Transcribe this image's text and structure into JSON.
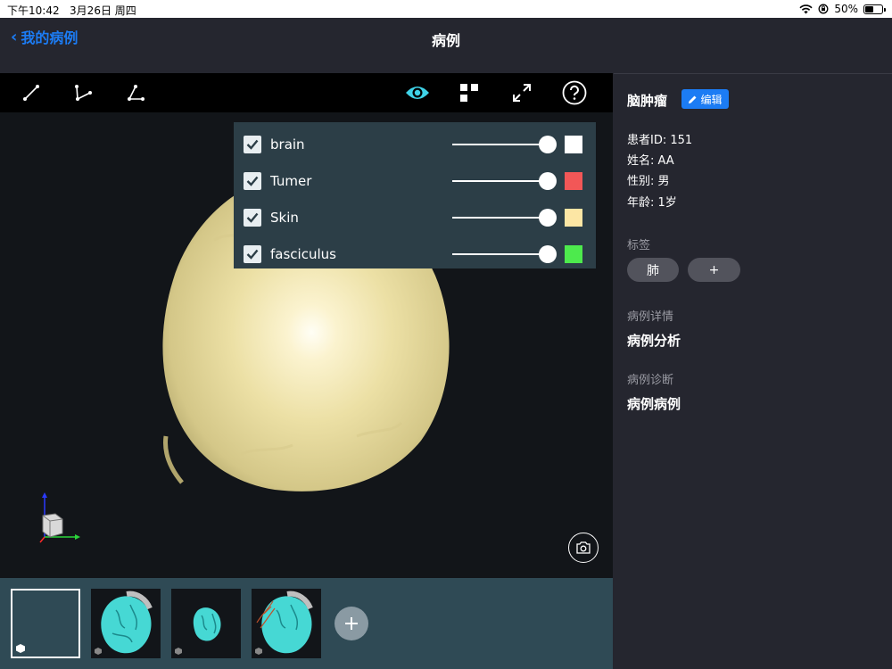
{
  "status": {
    "time": "下午10:42",
    "date": "3月26日 周四",
    "battery": "50%",
    "battery_level": 0.5
  },
  "nav": {
    "back_label": "我的病例",
    "title": "病例"
  },
  "toolbar": {
    "left_tools": [
      "line-measure-icon",
      "angle-measure-icon",
      "triangle-measure-icon"
    ],
    "right_tools": [
      "eye-icon",
      "grid-icon",
      "fullscreen-icon",
      "help-icon"
    ],
    "accent": "#3fd3e8"
  },
  "layers": [
    {
      "name": "brain",
      "checked": true,
      "opacity": 1.0,
      "color": "#ffffff"
    },
    {
      "name": "Tumer",
      "checked": true,
      "opacity": 1.0,
      "color": "#f25757"
    },
    {
      "name": "Skin",
      "checked": true,
      "opacity": 1.0,
      "color": "#fce6a4"
    },
    {
      "name": "fasciculus",
      "checked": true,
      "opacity": 1.0,
      "color": "#4dea4d"
    }
  ],
  "case": {
    "diagnosis": "脑肿瘤",
    "edit_label": "编辑",
    "patient_id": "患者ID: 151",
    "name": "姓名: AA",
    "gender": "性别: 男",
    "age": "年龄: 1岁",
    "tags_label": "标签",
    "tags": [
      "肺"
    ],
    "add_tag": "+",
    "detail_label": "病例详情",
    "detail_value": "病例分析",
    "diag_label": "病例诊断",
    "diag_value": "病例病例"
  },
  "colors": {
    "primary": "#1c7cf4",
    "background": "#25262f",
    "viewer": "#121519",
    "thumbbar": "#2f4a55"
  }
}
